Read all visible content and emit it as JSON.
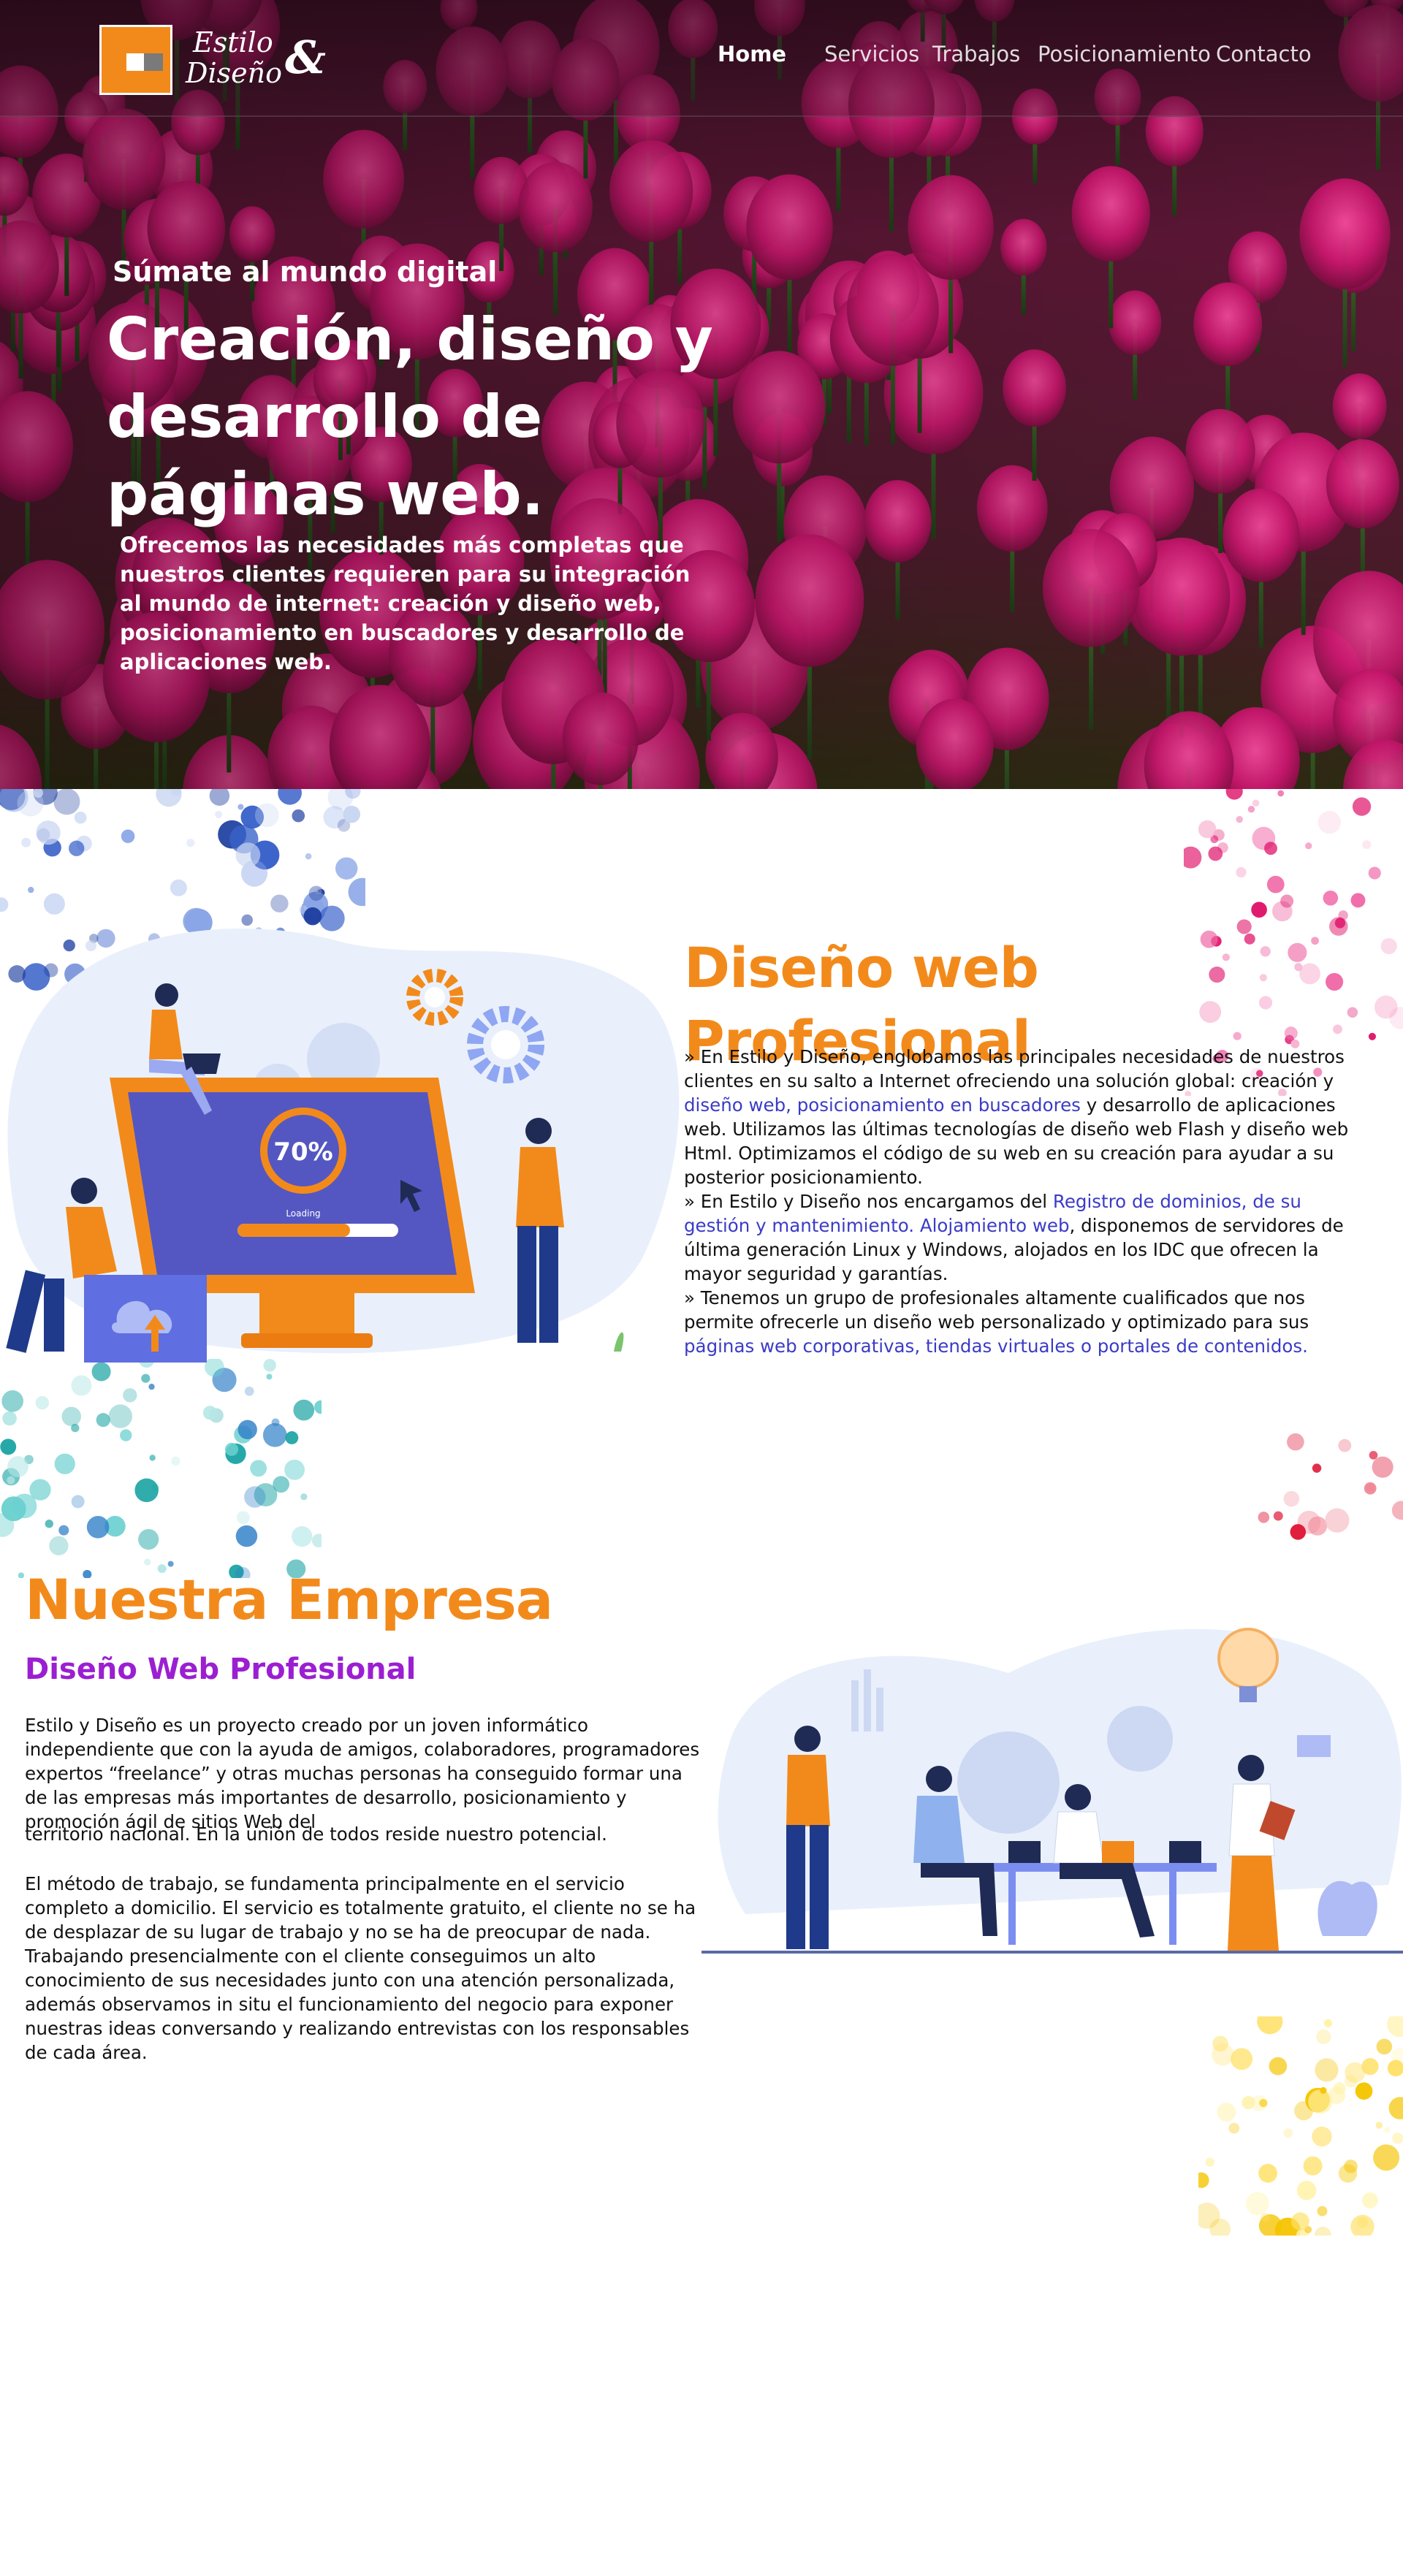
{
  "nav": {
    "logo_line1": "Estilo",
    "logo_line2": "Diseño",
    "logo_amp": "&",
    "items": [
      {
        "label": "Home",
        "active": true
      },
      {
        "label": "Servicios",
        "active": false
      },
      {
        "label": "Trabajos",
        "active": false
      },
      {
        "label": "Posicionamiento",
        "active": false
      },
      {
        "label": "Contacto",
        "active": false
      }
    ]
  },
  "hero": {
    "kicker": "Súmate al mundo digital",
    "title": "Creación, diseño y desarrollo de páginas web.",
    "description": "Ofrecemos las necesidades más completas que nuestros clientes requieren para su integración al mundo de internet: creación y diseño web, posicionamiento en buscadores y desarrollo de aplicaciones web."
  },
  "section1": {
    "title": "Diseño web Profesional",
    "illustration_progress": "70%",
    "illustration_loading": "Loading",
    "p1_a": "» En Estilo y Diseño, englobamos las principales necesidades de nuestros clientes en su salto a Internet ofreciendo una solución global: creación y ",
    "p1_link": "diseño web, posicionamiento en buscadores",
    "p1_b": " y desarrollo de aplicaciones web. Utilizamos las últimas tecnologías de diseño web Flash y diseño web Html. Optimizamos el código de su web en su creación para ayudar a su posterior posicionamiento.",
    "p2_a": "» En Estilo y Diseño nos encargamos del ",
    "p2_link": "Registro de dominios, de su gestión y mantenimiento. Alojamiento web",
    "p2_b": ", disponemos de servidores de última generación Linux y Windows, alojados en los IDC que ofrecen la mayor seguridad y garantías.",
    "p3_a": "» Tenemos un grupo de profesionales altamente cualificados que nos permite ofrecerle un diseño web personalizado y optimizado para sus ",
    "p3_link": "páginas web corporativas, tiendas virtuales o portales de contenidos."
  },
  "section2": {
    "title": "Nuestra Empresa",
    "subtitle": "Diseño Web Profesional",
    "p1": "Estilo y Diseño es un proyecto creado por un joven informático independiente que con la ayuda de amigos, colaboradores, programadores expertos “freelance” y otras muchas personas ha conseguido formar una de las empresas más importantes de desarrollo, posicionamiento y promoción ágil de sitios Web del",
    "p2": "territorio nacional. En la unión de todos reside nuestro potencial.",
    "p3": "El método de trabajo, se fundamenta principalmente en el servicio completo a domicilio. El servicio es totalmente gratuito, el cliente no se ha de desplazar de su lugar de trabajo y no se ha de preocupar de nada. Trabajando presencialmente con el cliente conseguimos un alto conocimiento de sus necesidades junto con una atención personalizada, además observamos in situ el funcionamiento del negocio para exponer nuestras ideas conversando y realizando entrevistas con los responsables de cada área."
  },
  "colors": {
    "accent_orange": "#f28a1b",
    "subtitle_purple": "#9b1fd1",
    "link_blue": "#3b3bc7"
  }
}
